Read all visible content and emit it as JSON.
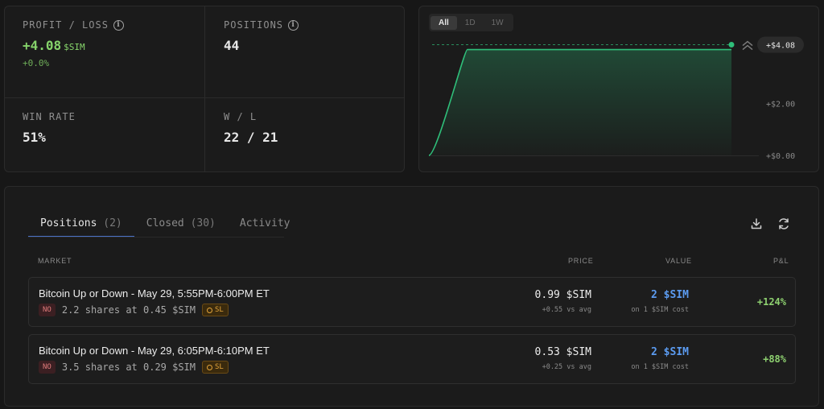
{
  "stats": {
    "profit_loss": {
      "label": "PROFIT / LOSS",
      "value": "+4.08",
      "unit": "$SIM",
      "change": "+0.0%"
    },
    "positions": {
      "label": "POSITIONS",
      "value": "44"
    },
    "win_rate": {
      "label": "WIN RATE",
      "value": "51%"
    },
    "win_loss": {
      "label": "W / L",
      "value": "22 / 21"
    }
  },
  "chart": {
    "range_tabs": [
      "All",
      "1D",
      "1W"
    ],
    "active_range": "All",
    "current_label": "+$4.08",
    "y_ticks": [
      "+$2.00",
      "+$0.00"
    ],
    "accent_color": "#2fbf7a"
  },
  "chart_data": {
    "type": "area",
    "title": "",
    "xlabel": "",
    "ylabel": "",
    "series": [
      {
        "values": [
          0.0,
          0.3,
          4.08,
          4.08,
          4.08,
          4.08,
          4.08,
          4.08,
          4.08,
          4.08
        ]
      }
    ],
    "ylim": [
      0,
      4.5
    ],
    "y_ticks": [
      0,
      2
    ],
    "current_value": 4.08,
    "grid": false
  },
  "positions_panel": {
    "tabs": [
      {
        "label": "Positions",
        "count": "(2)"
      },
      {
        "label": "Closed",
        "count": "(30)"
      },
      {
        "label": "Activity",
        "count": ""
      }
    ],
    "columns": {
      "market": "MARKET",
      "price": "PRICE",
      "value": "VALUE",
      "pnl": "P&L"
    },
    "rows": [
      {
        "title": "Bitcoin Up or Down - May 29, 5:55PM-6:00PM ET",
        "side": "NO",
        "shares": "2.2 shares at 0.45 $SIM",
        "sl": "SL",
        "price": "0.99 $SIM",
        "price_sub": "+0.55 vs avg",
        "value": "2 $SIM",
        "value_sub": "on 1 $SIM cost",
        "pnl": "+124%"
      },
      {
        "title": "Bitcoin Up or Down - May 29, 6:05PM-6:10PM ET",
        "side": "NO",
        "shares": "3.5 shares at 0.29 $SIM",
        "sl": "SL",
        "price": "0.53 $SIM",
        "price_sub": "+0.25 vs avg",
        "value": "2 $SIM",
        "value_sub": "on 1 $SIM cost",
        "pnl": "+88%"
      }
    ]
  }
}
